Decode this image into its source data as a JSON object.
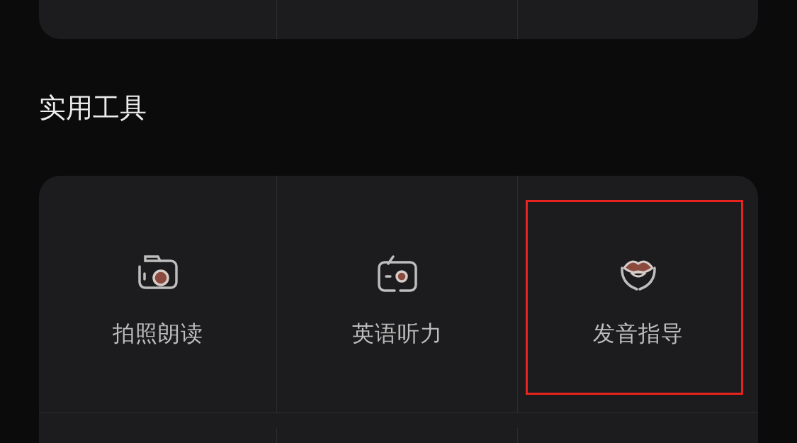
{
  "section_title": "实用工具",
  "tools": [
    {
      "label": "拍照朗读",
      "highlighted": false
    },
    {
      "label": "英语听力",
      "highlighted": false
    },
    {
      "label": "发音指导",
      "highlighted": true
    }
  ]
}
